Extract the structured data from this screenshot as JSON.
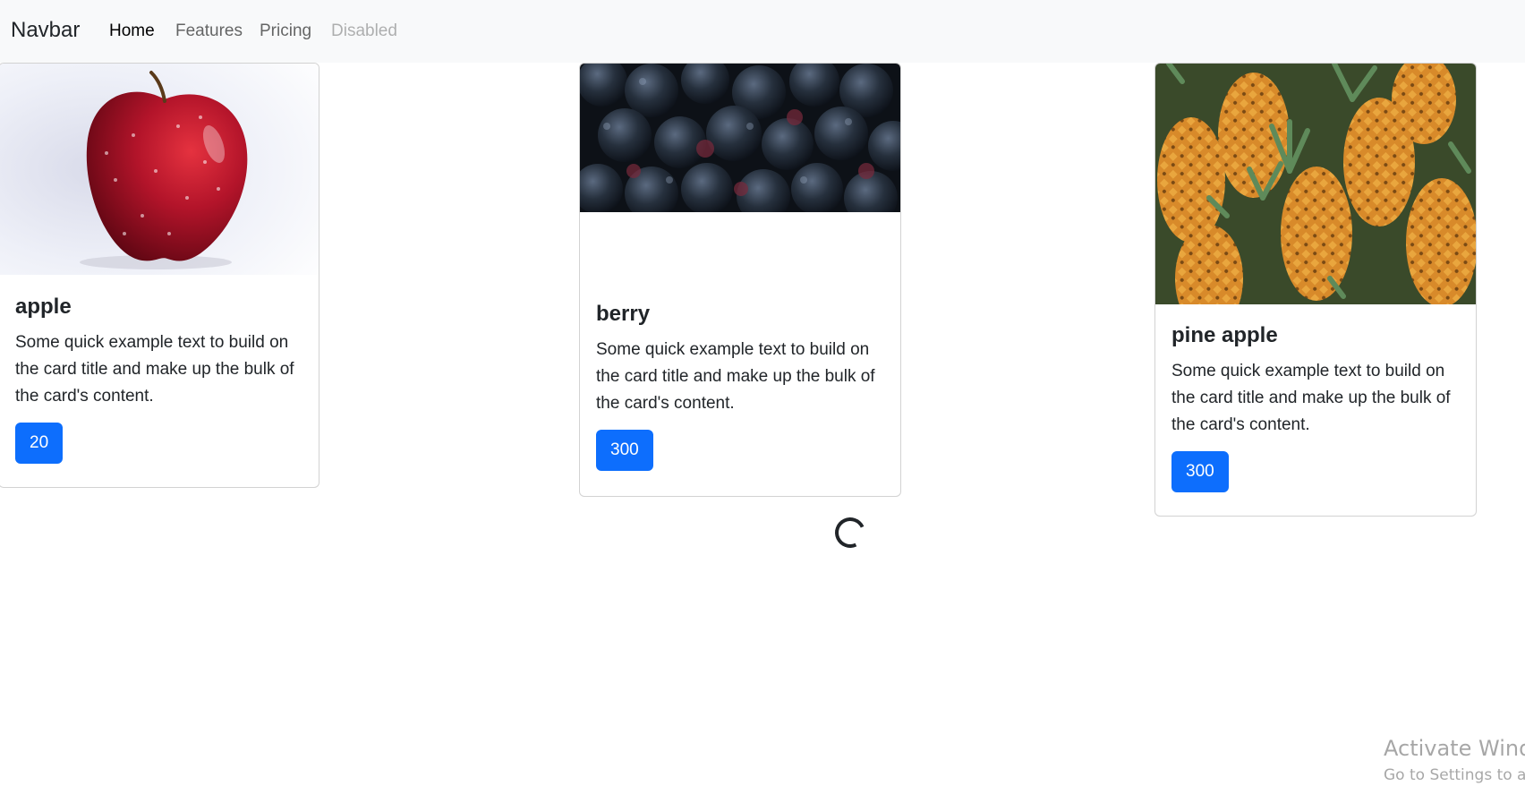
{
  "navbar": {
    "brand": "Navbar",
    "links": [
      {
        "label": "Home",
        "state": "active"
      },
      {
        "label": "Features",
        "state": "normal"
      },
      {
        "label": "Pricing",
        "state": "normal"
      },
      {
        "label": "Disabled",
        "state": "disabled"
      }
    ]
  },
  "cards": [
    {
      "image": "apple-photo",
      "title": "apple",
      "text": "Some quick example text to build on the card title and make up the bulk of the card's content.",
      "button_label": "20"
    },
    {
      "image": "berry-photo",
      "title": "berry",
      "text": "Some quick example text to build on the card title and make up the bulk of the card's content.",
      "button_label": "300"
    },
    {
      "image": "pineapple-photo",
      "title": "pine apple",
      "text": "Some quick example text to build on the card title and make up the bulk of the card's content.",
      "button_label": "300"
    }
  ],
  "loading_spinner": "loading-spinner-icon",
  "watermark": {
    "title": "Activate Windows",
    "subtitle": "Go to Settings to activate Windows."
  },
  "colors": {
    "primary": "#0d6efd",
    "navbar_bg": "#f8f9fa"
  }
}
